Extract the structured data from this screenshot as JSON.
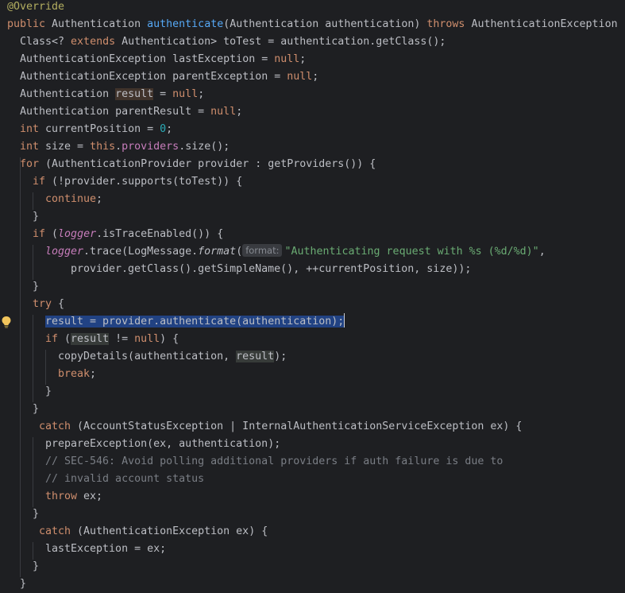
{
  "editor": {
    "lines": [
      {
        "indent": 0,
        "tokens": [
          [
            "ann",
            "@Override"
          ]
        ]
      },
      {
        "indent": 0,
        "tokens": [
          [
            "kw",
            "public "
          ],
          [
            "plain",
            "Authentication "
          ],
          [
            "fn",
            "authenticate"
          ],
          [
            "plain",
            "(Authentication authentication) "
          ],
          [
            "kw",
            "throws "
          ],
          [
            "plain",
            "AuthenticationException {"
          ]
        ]
      },
      {
        "indent": 1,
        "tokens": [
          [
            "plain",
            "Class<? "
          ],
          [
            "kw",
            "extends "
          ],
          [
            "plain",
            "Authentication> toTest = authentication.getClass();"
          ]
        ]
      },
      {
        "indent": 1,
        "tokens": [
          [
            "plain",
            "AuthenticationException lastException = "
          ],
          [
            "kw",
            "null"
          ],
          [
            "plain",
            ";"
          ]
        ]
      },
      {
        "indent": 1,
        "tokens": [
          [
            "plain",
            "AuthenticationException parentException = "
          ],
          [
            "kw",
            "null"
          ],
          [
            "plain",
            ";"
          ]
        ]
      },
      {
        "indent": 1,
        "tokens": [
          [
            "plain",
            "Authentication "
          ],
          [
            "occ-write",
            "result"
          ],
          [
            "plain",
            " = "
          ],
          [
            "kw",
            "null"
          ],
          [
            "plain",
            ";"
          ]
        ]
      },
      {
        "indent": 1,
        "tokens": [
          [
            "plain",
            "Authentication parentResult = "
          ],
          [
            "kw",
            "null"
          ],
          [
            "plain",
            ";"
          ]
        ]
      },
      {
        "indent": 1,
        "tokens": [
          [
            "kw",
            "int "
          ],
          [
            "plain",
            "currentPosition = "
          ],
          [
            "num",
            "0"
          ],
          [
            "plain",
            ";"
          ]
        ]
      },
      {
        "indent": 1,
        "tokens": [
          [
            "kw",
            "int "
          ],
          [
            "plain",
            "size = "
          ],
          [
            "kw",
            "this"
          ],
          [
            "plain",
            "."
          ],
          [
            "fld",
            "providers"
          ],
          [
            "plain",
            ".size();"
          ]
        ]
      },
      {
        "indent": 1,
        "tokens": [
          [
            "kw",
            "for "
          ],
          [
            "plain",
            "(AuthenticationProvider provider : getProviders()) {"
          ]
        ]
      },
      {
        "indent": 2,
        "tokens": [
          [
            "kw",
            "if "
          ],
          [
            "plain",
            "(!provider.supports(toTest)) {"
          ]
        ]
      },
      {
        "indent": 3,
        "tokens": [
          [
            "kw",
            "continue"
          ],
          [
            "plain",
            ";"
          ]
        ]
      },
      {
        "indent": 2,
        "tokens": [
          [
            "plain",
            "}"
          ]
        ]
      },
      {
        "indent": 2,
        "tokens": [
          [
            "kw",
            "if "
          ],
          [
            "plain",
            "("
          ],
          [
            "stf",
            "logger"
          ],
          [
            "plain",
            ".isTraceEnabled()) {"
          ]
        ]
      },
      {
        "indent": 3,
        "tokens": [
          [
            "stf",
            "logger"
          ],
          [
            "plain",
            ".trace(LogMessage."
          ],
          [
            "smi",
            "format"
          ],
          [
            "plain",
            "("
          ],
          [
            "hint",
            "format:"
          ],
          [
            "str",
            "\"Authenticating request with %s (%d/%d)\""
          ],
          [
            "plain",
            ","
          ]
        ]
      },
      {
        "indent": 5,
        "tokens": [
          [
            "plain",
            "provider.getClass().getSimpleName(), ++currentPosition, size));"
          ]
        ]
      },
      {
        "indent": 2,
        "tokens": [
          [
            "plain",
            "}"
          ]
        ]
      },
      {
        "indent": 2,
        "tokens": [
          [
            "kw",
            "try "
          ],
          [
            "plain",
            "{"
          ]
        ]
      },
      {
        "indent": 3,
        "tokens": [
          [
            "sel",
            "result = provider.authenticate(authentication);"
          ],
          [
            "caret",
            ""
          ]
        ]
      },
      {
        "indent": 3,
        "tokens": [
          [
            "kw",
            "if "
          ],
          [
            "plain",
            "("
          ],
          [
            "occ-read",
            "result"
          ],
          [
            "plain",
            " != "
          ],
          [
            "kw",
            "null"
          ],
          [
            "plain",
            ") {"
          ]
        ]
      },
      {
        "indent": 4,
        "tokens": [
          [
            "plain",
            "copyDetails(authentication, "
          ],
          [
            "occ-read",
            "result"
          ],
          [
            "plain",
            ");"
          ]
        ]
      },
      {
        "indent": 4,
        "tokens": [
          [
            "kw",
            "break"
          ],
          [
            "plain",
            ";"
          ]
        ]
      },
      {
        "indent": 3,
        "tokens": [
          [
            "plain",
            "}"
          ]
        ]
      },
      {
        "indent": 2,
        "tokens": [
          [
            "plain",
            "}"
          ]
        ]
      },
      {
        "indent": 2,
        "tokens": [
          [
            "kw",
            " catch "
          ],
          [
            "plain",
            "(AccountStatusException | InternalAuthenticationServiceException ex) {"
          ]
        ]
      },
      {
        "indent": 3,
        "tokens": [
          [
            "plain",
            "prepareException(ex, authentication);"
          ]
        ]
      },
      {
        "indent": 3,
        "tokens": [
          [
            "cmt",
            "// SEC-546: Avoid polling additional providers if auth failure is due to"
          ]
        ]
      },
      {
        "indent": 3,
        "tokens": [
          [
            "cmt",
            "// invalid account status"
          ]
        ]
      },
      {
        "indent": 3,
        "tokens": [
          [
            "kw",
            "throw "
          ],
          [
            "plain",
            "ex;"
          ]
        ]
      },
      {
        "indent": 2,
        "tokens": [
          [
            "plain",
            "}"
          ]
        ]
      },
      {
        "indent": 2,
        "tokens": [
          [
            "kw",
            " catch "
          ],
          [
            "plain",
            "(AuthenticationException ex) {"
          ]
        ]
      },
      {
        "indent": 3,
        "tokens": [
          [
            "plain",
            "lastException = ex;"
          ]
        ]
      },
      {
        "indent": 2,
        "tokens": [
          [
            "plain",
            "}"
          ]
        ]
      },
      {
        "indent": 1,
        "tokens": [
          [
            "plain",
            "}"
          ]
        ]
      }
    ],
    "colors": {
      "background": "#1e1f22",
      "keyword": "#cf8e6d",
      "annotation": "#b3ae60",
      "method": "#56a8f5",
      "string": "#6aab73",
      "number": "#2aacb8",
      "field": "#c77dbb",
      "comment": "#7a7e85",
      "selection": "#214283"
    },
    "gutter_icon": "lightbulb-icon"
  }
}
